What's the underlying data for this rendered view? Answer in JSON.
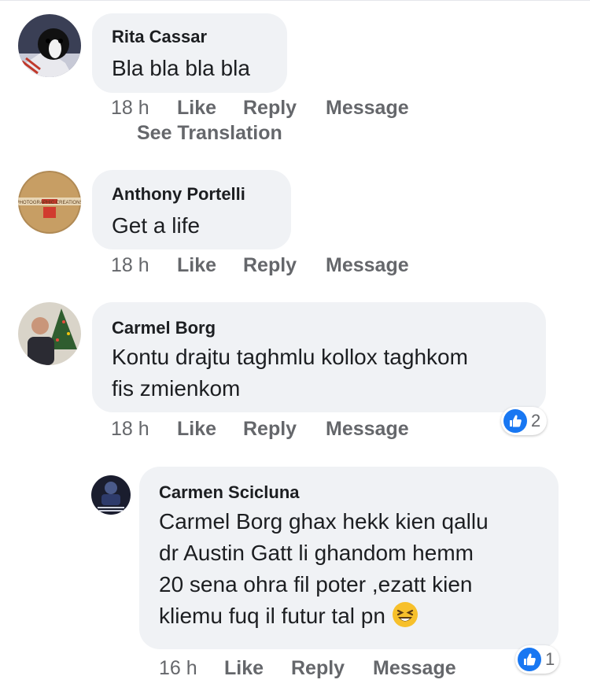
{
  "actions": {
    "like": "Like",
    "reply": "Reply",
    "message": "Message"
  },
  "comments": [
    {
      "author": "Rita Cassar",
      "lines": [
        "Bla bla bla bla"
      ],
      "time": "18 h",
      "see_translation": "See Translation"
    },
    {
      "author": "Anthony Portelli",
      "lines": [
        "Get a life"
      ],
      "time": "18 h",
      "avatar_text": "PHOTOGRAPHIC CREATIONS"
    },
    {
      "author": "Carmel Borg",
      "lines": [
        "Kontu drajtu taghmlu kollox taghkom",
        "fis zmienkom"
      ],
      "time": "18 h",
      "reactions": {
        "type": "like",
        "count": "2"
      }
    }
  ],
  "reply": {
    "author": "Carmen Scicluna",
    "lines": [
      "Carmel Borg ghax hekk kien qallu",
      "dr Austin Gatt li ghandom hemm",
      "20 sena ohra fil poter ,ezatt kien",
      "kliemu fuq il futur tal pn"
    ],
    "emoji": "laughing-emoji",
    "time": "16 h",
    "reactions": {
      "type": "like",
      "count": "1"
    }
  },
  "colors": {
    "bubble": "#f0f2f5",
    "meta": "#65676b",
    "text": "#1c1e21",
    "like_blue": "#1877f2"
  }
}
